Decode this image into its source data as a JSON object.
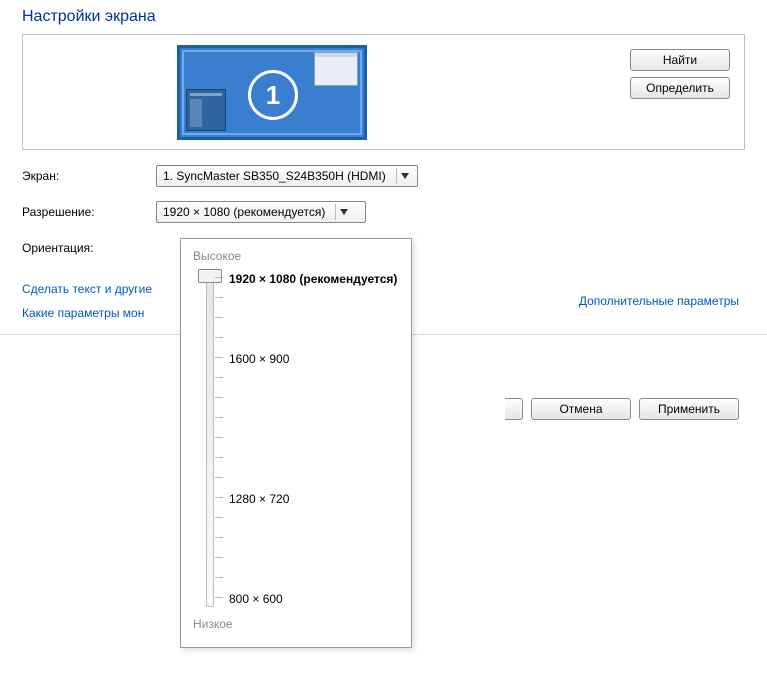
{
  "title": "Настройки экрана",
  "preview": {
    "monitor_number": "1"
  },
  "buttons": {
    "find": "Найти",
    "identify": "Определить",
    "cancel": "Отмена",
    "apply": "Применить"
  },
  "labels": {
    "screen": "Экран:",
    "resolution": "Разрешение:",
    "orientation": "Ориентация:"
  },
  "dropdowns": {
    "screen": "1. SyncMaster SB350_S24B350H (HDMI)",
    "resolution": "1920 × 1080 (рекомендуется)"
  },
  "links": {
    "advanced": "Дополнительные параметры",
    "text_size": "Сделать текст и другие",
    "which_params": "Какие параметры мон"
  },
  "slider": {
    "high": "Высокое",
    "low": "Низкое",
    "options": [
      {
        "label": "1920 × 1080 (рекомендуется)",
        "selected": true
      },
      {
        "label": "1600 × 900"
      },
      {
        "label": "1280 × 720"
      },
      {
        "label": "800 × 600"
      }
    ]
  }
}
